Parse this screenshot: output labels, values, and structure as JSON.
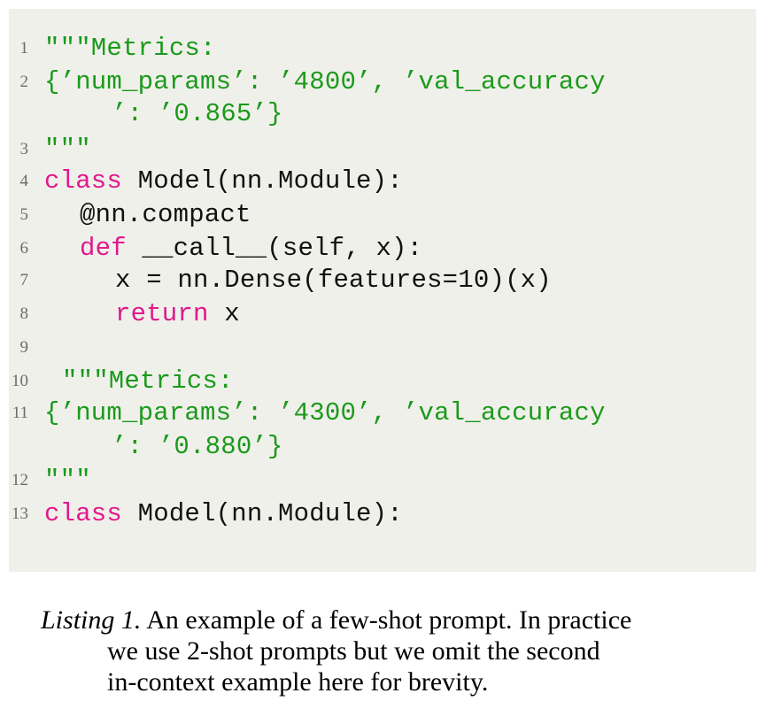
{
  "listing": {
    "lines": [
      {
        "num": "1",
        "segments": [
          {
            "t": "\"\"\"Metrics:",
            "c": "str"
          }
        ]
      },
      {
        "num": "2",
        "segments": [
          {
            "t": "{’num_params’: ’4800’, ’val_accuracy",
            "c": "str"
          }
        ]
      },
      {
        "num": "",
        "segments": [
          {
            "t": "’: ’0.865’}",
            "c": "str"
          }
        ]
      },
      {
        "num": "3",
        "segments": [
          {
            "t": "\"\"\"",
            "c": "str"
          }
        ]
      },
      {
        "num": "4",
        "segments": [
          {
            "t": "class",
            "c": "kw"
          },
          {
            "t": " Model(nn.Module):",
            "c": "plain"
          }
        ]
      },
      {
        "num": "5",
        "segments": [
          {
            "t": "@nn.compact",
            "c": "plain"
          }
        ]
      },
      {
        "num": "6",
        "segments": [
          {
            "t": "def",
            "c": "kw"
          },
          {
            "t": " __call__(self, x):",
            "c": "plain"
          }
        ]
      },
      {
        "num": "7",
        "segments": [
          {
            "t": "x = nn.Dense(features=10)(x)",
            "c": "plain"
          }
        ]
      },
      {
        "num": "8",
        "segments": [
          {
            "t": "return",
            "c": "kw"
          },
          {
            "t": " x",
            "c": "plain"
          }
        ]
      },
      {
        "num": "9",
        "segments": []
      },
      {
        "num": "10",
        "segments": [
          {
            "t": "\"\"\"Metrics:",
            "c": "str"
          }
        ]
      },
      {
        "num": "11",
        "segments": [
          {
            "t": "{’num_params’: ’4300’, ’val_accuracy",
            "c": "str"
          }
        ]
      },
      {
        "num": "",
        "segments": [
          {
            "t": "’: ’0.880’}",
            "c": "str"
          }
        ]
      },
      {
        "num": "12",
        "segments": [
          {
            "t": "\"\"\"",
            "c": "str"
          }
        ]
      },
      {
        "num": "13",
        "segments": [
          {
            "t": "class",
            "c": "kw"
          },
          {
            "t": " Model(nn.Module):",
            "c": "plain"
          }
        ]
      }
    ]
  },
  "caption": {
    "label": "Listing 1.",
    "line1": " An example of a few-shot prompt. In practice",
    "line2": "we use 2-shot prompts but we omit the second",
    "line3": "in-context example here for brevity."
  }
}
